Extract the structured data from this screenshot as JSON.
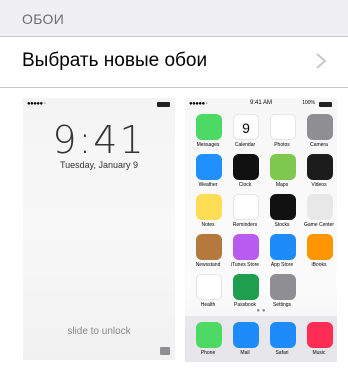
{
  "section": {
    "title": "ОБОИ"
  },
  "row": {
    "label": "Выбрать новые обои"
  },
  "lock": {
    "time": "9:41",
    "date": "Tuesday, January 9",
    "unlock_text": "slide to unlock"
  },
  "home": {
    "status_time": "9:41 AM",
    "battery": "100%",
    "apps": [
      {
        "name": "Messages",
        "color": "#4cd964"
      },
      {
        "name": "Calendar",
        "color": "#ffffff"
      },
      {
        "name": "Photos",
        "color": "#ffffff"
      },
      {
        "name": "Camera",
        "color": "#8e8e93"
      },
      {
        "name": "Weather",
        "color": "#1e90ff"
      },
      {
        "name": "Clock",
        "color": "#111111"
      },
      {
        "name": "Maps",
        "color": "#7ec850"
      },
      {
        "name": "Videos",
        "color": "#1c1c1c"
      },
      {
        "name": "Notes",
        "color": "#ffdd55"
      },
      {
        "name": "Reminders",
        "color": "#ffffff"
      },
      {
        "name": "Stocks",
        "color": "#111111"
      },
      {
        "name": "Game Center",
        "color": "#e8e8e8"
      },
      {
        "name": "Newsstand",
        "color": "#b5793e"
      },
      {
        "name": "iTunes Store",
        "color": "#b85cf0"
      },
      {
        "name": "App Store",
        "color": "#1d8cf8"
      },
      {
        "name": "iBooks",
        "color": "#ff9500"
      },
      {
        "name": "Health",
        "color": "#ffffff"
      },
      {
        "name": "Passbook",
        "color": "#1f9e4f"
      },
      {
        "name": "Settings",
        "color": "#8e8e93"
      }
    ],
    "dock": [
      {
        "name": "Phone",
        "color": "#4cd964"
      },
      {
        "name": "Mail",
        "color": "#1d8cf8"
      },
      {
        "name": "Safari",
        "color": "#1d8cf8"
      },
      {
        "name": "Music",
        "color": "#ff2d55"
      }
    ],
    "calendar_day": "9"
  }
}
